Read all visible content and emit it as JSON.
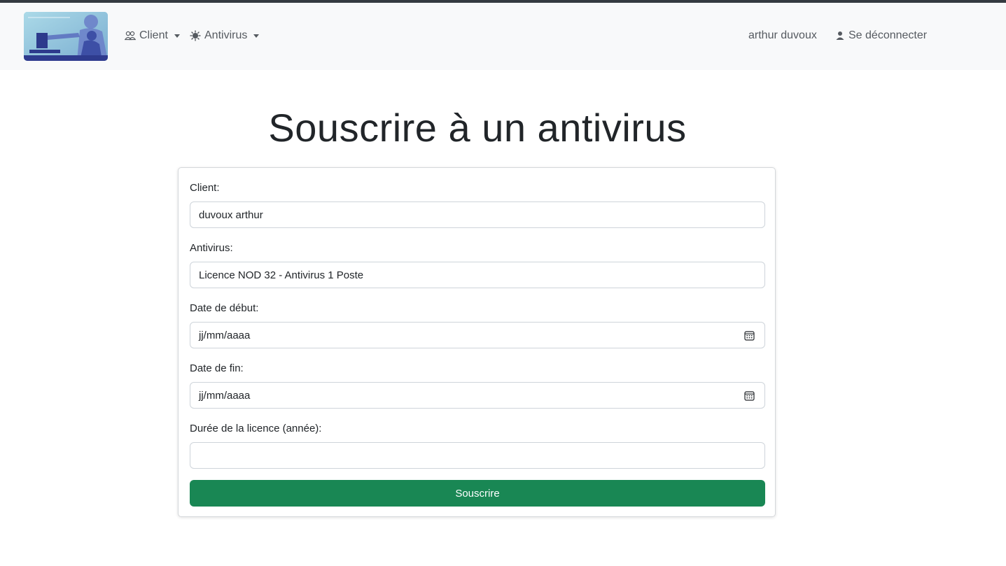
{
  "navbar": {
    "logo_alt": "logo",
    "menu": [
      {
        "label": "Client",
        "icon": "people-icon"
      },
      {
        "label": "Antivirus",
        "icon": "virus-icon"
      }
    ],
    "user_name": "arthur duvoux",
    "logout_label": "Se déconnecter"
  },
  "page": {
    "title": "Souscrire à un antivirus"
  },
  "form": {
    "client_label": "Client:",
    "client_value": "duvoux arthur",
    "antivirus_label": "Antivirus:",
    "antivirus_value": "Licence NOD 32 - Antivirus 1 Poste",
    "start_date_label": "Date de début:",
    "start_date_placeholder": "jj/mm/aaaa",
    "end_date_label": "Date de fin:",
    "end_date_placeholder": "jj/mm/aaaa",
    "duration_label": "Durée de la licence (année):",
    "duration_value": "",
    "submit_label": "Souscrire"
  },
  "colors": {
    "submit_bg": "#198754",
    "navbar_bg": "#f8f9fa"
  }
}
